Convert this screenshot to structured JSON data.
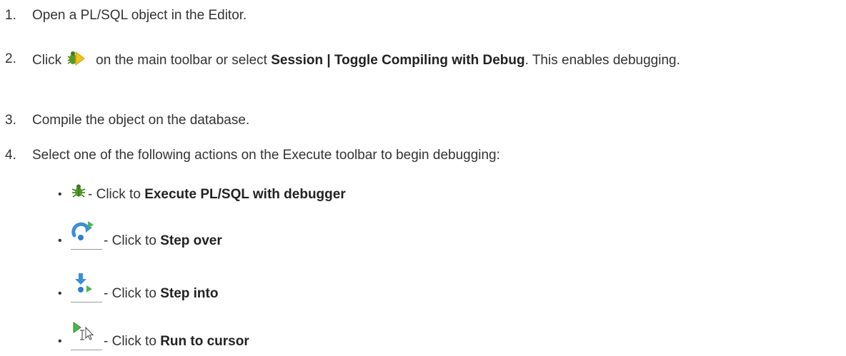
{
  "steps": [
    {
      "num": "1.",
      "text": "Open a PL/SQL object in the Editor."
    },
    {
      "num": "2.",
      "pre": "Click",
      "mid": "on the main toolbar or select",
      "bold": "Session | Toggle Compiling with Debug",
      "post": ". This enables debugging.",
      "icon": "toggle-compile-debug-icon"
    },
    {
      "num": "3.",
      "text": "Compile the object on the database."
    },
    {
      "num": "4.",
      "text": "Select one of the following actions on the Execute toolbar to begin debugging:"
    }
  ],
  "bullets": [
    {
      "icon": "execute-with-debugger-icon",
      "prefix": "- Click to ",
      "bold": "Execute PL/SQL with debugger"
    },
    {
      "icon": "step-over-icon",
      "prefix": "- Click to ",
      "bold": "Step over"
    },
    {
      "icon": "step-into-icon",
      "prefix": "- Click to ",
      "bold": "Step into"
    },
    {
      "icon": "run-to-cursor-icon",
      "prefix": "- Click to ",
      "bold": "Run to cursor"
    }
  ],
  "bullet_glyph": "•"
}
